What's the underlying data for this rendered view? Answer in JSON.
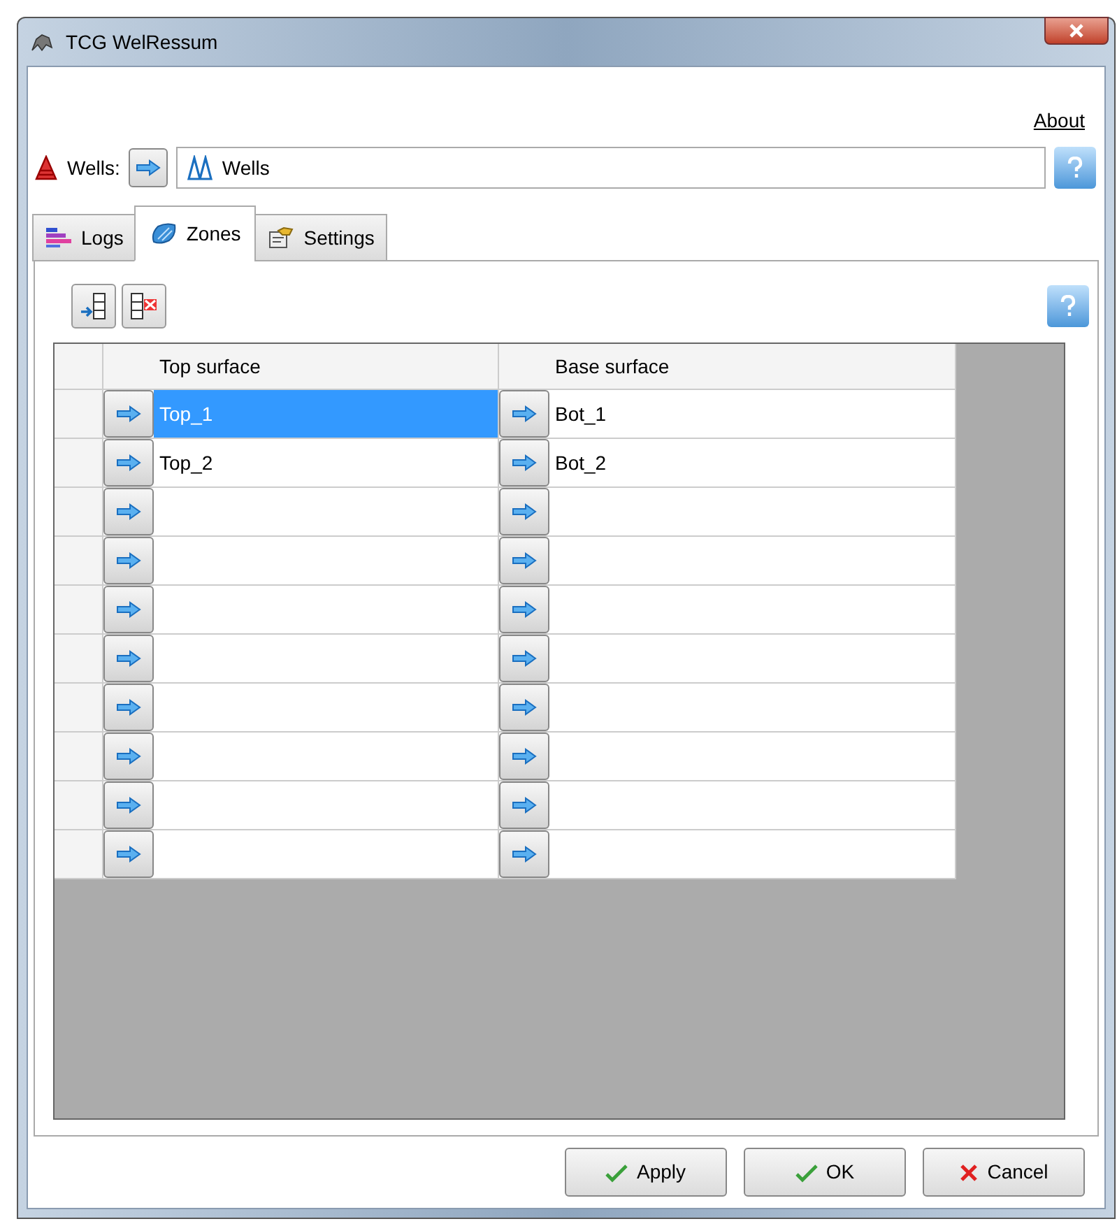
{
  "window": {
    "title": "TCG WelRessum"
  },
  "about_link": "About",
  "wells": {
    "label": "Wells:",
    "value": "Wells"
  },
  "tabs": [
    {
      "label": "Logs",
      "selected": false,
      "kind": "logs"
    },
    {
      "label": "Zones",
      "selected": true,
      "kind": "zones"
    },
    {
      "label": "Settings",
      "selected": false,
      "kind": "settings"
    }
  ],
  "table": {
    "columns": [
      "Top surface",
      "Base surface"
    ],
    "rows": [
      {
        "top": {
          "text": "Top_1",
          "selected": true
        },
        "base": {
          "text": "Bot_1",
          "selected": false
        }
      },
      {
        "top": {
          "text": "Top_2",
          "selected": false
        },
        "base": {
          "text": "Bot_2",
          "selected": false
        }
      },
      {
        "top": {
          "selected": false
        },
        "base": {
          "selected": false
        }
      },
      {
        "top": {
          "selected": false
        },
        "base": {
          "selected": false
        }
      },
      {
        "top": {
          "selected": false
        },
        "base": {
          "selected": false
        }
      },
      {
        "top": {
          "selected": false
        },
        "base": {
          "selected": false
        }
      },
      {
        "top": {
          "selected": false
        },
        "base": {
          "selected": false
        }
      },
      {
        "top": {
          "selected": false
        },
        "base": {
          "selected": false
        }
      },
      {
        "top": {
          "selected": false
        },
        "base": {
          "selected": false
        }
      },
      {
        "top": {
          "selected": false
        },
        "base": {
          "selected": false
        }
      }
    ]
  },
  "buttons": [
    {
      "label": "Apply",
      "kind": "ok"
    },
    {
      "label": "OK",
      "kind": "ok"
    },
    {
      "label": "Cancel",
      "kind": "cancel"
    }
  ]
}
